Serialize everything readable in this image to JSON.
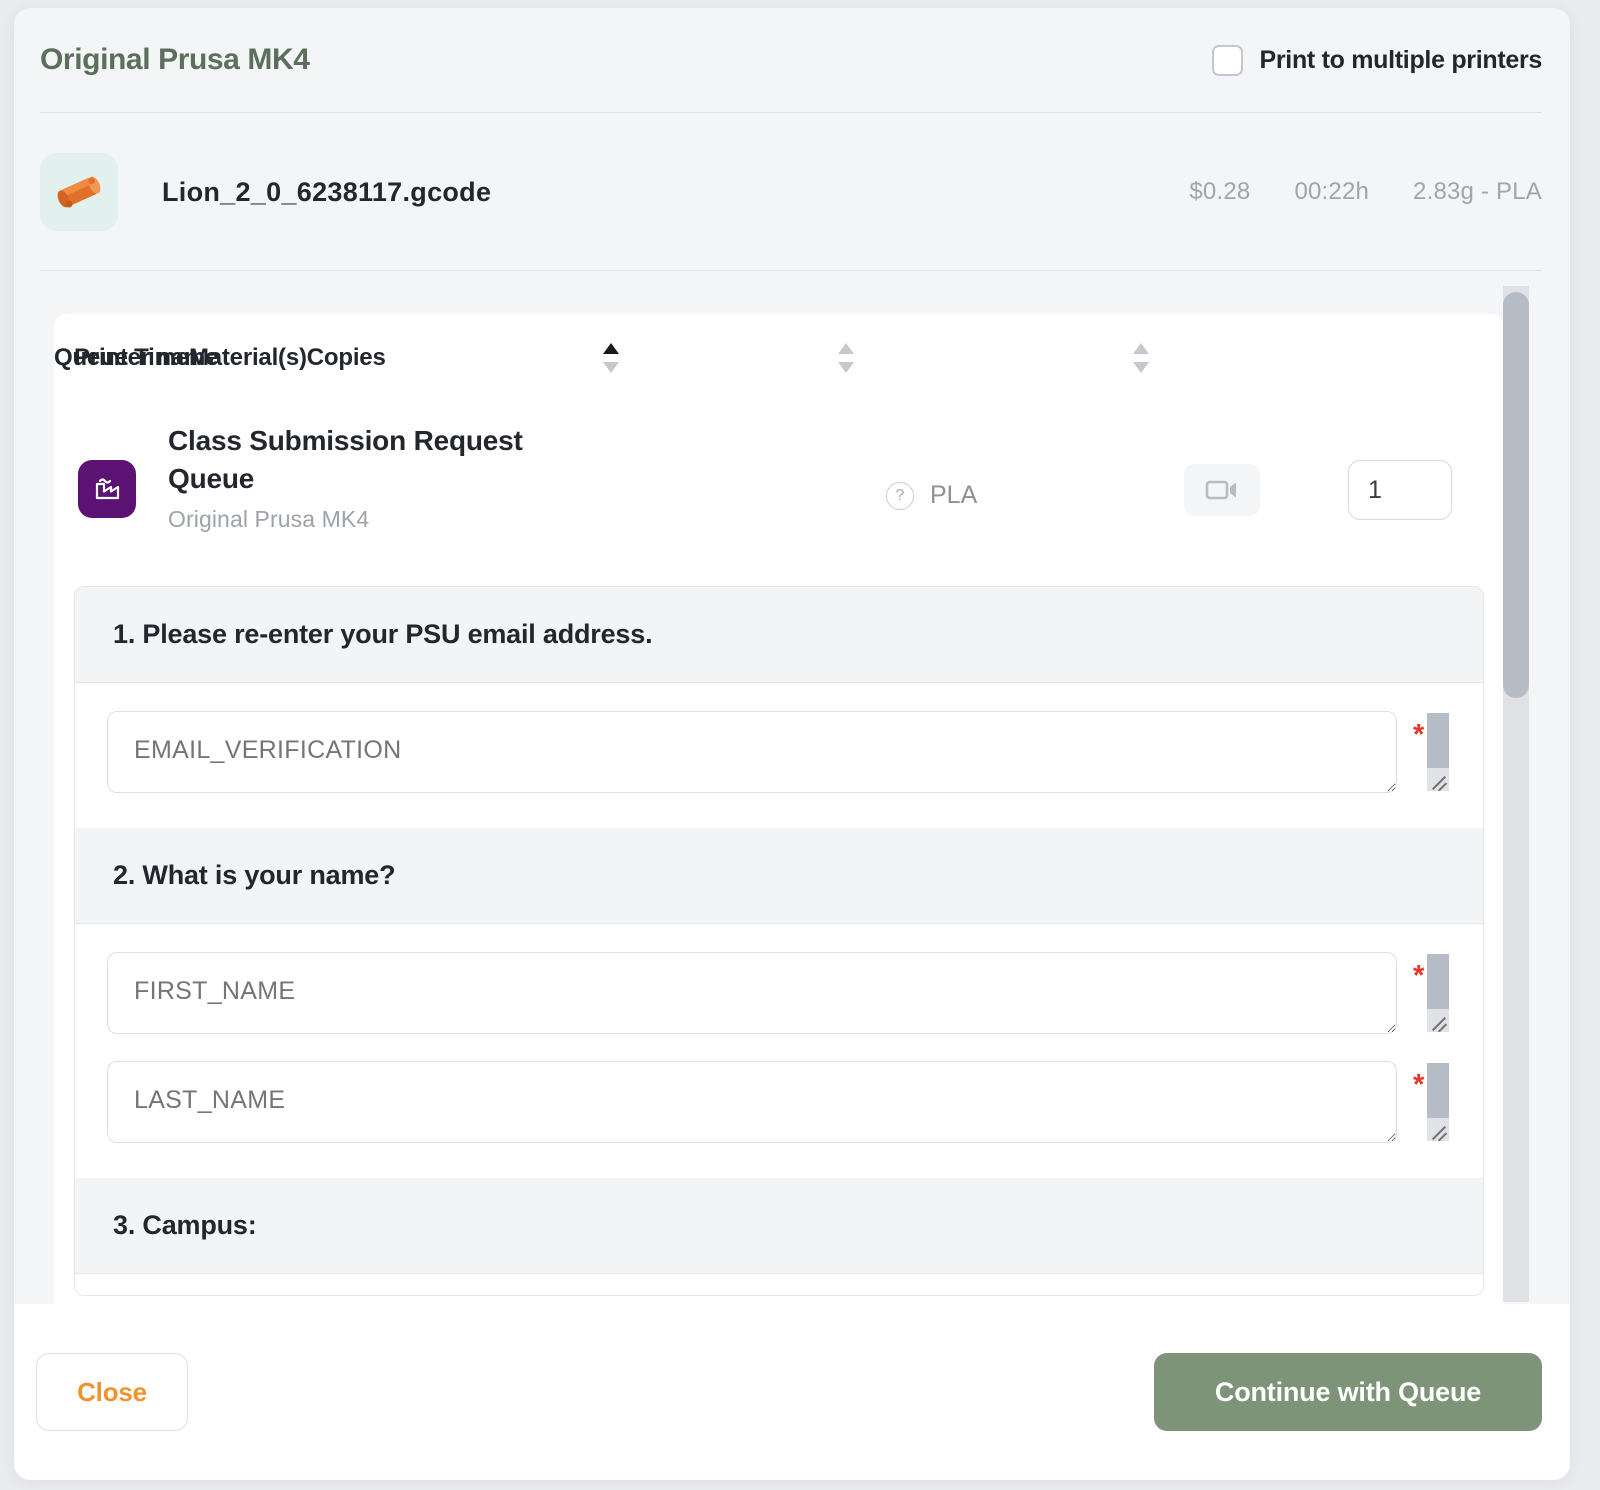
{
  "header": {
    "title": "Original Prusa MK4",
    "multi_printer_label": "Print to multiple printers",
    "multi_printer_checked": false
  },
  "file": {
    "name": "Lion_2_0_6238117.gcode",
    "cost": "$0.28",
    "duration": "00:22h",
    "weight_material": "2.83g - PLA",
    "thumbnail_icon": "3d-model-thumbnail"
  },
  "table": {
    "columns": [
      {
        "label": "Printer name",
        "sortable": true,
        "sort_state": "asc"
      },
      {
        "label": "Queue Time",
        "sortable": true,
        "sort_state": "none"
      },
      {
        "label": "Material(s)",
        "sortable": true,
        "sort_state": "none"
      },
      {
        "label": "Copies",
        "sortable": false,
        "sort_state": "none"
      }
    ],
    "row": {
      "printer_name": "Class Submission Request Queue",
      "printer_model": "Original Prusa MK4",
      "queue_time": "",
      "material": "PLA",
      "material_help_icon": "question-circle-icon",
      "camera_icon": "video-camera-icon",
      "copies_value": "1",
      "printer_avatar_icon": "factory-icon"
    }
  },
  "form": {
    "questions": [
      {
        "title": "1. Please re-enter your PSU email address.",
        "fields": [
          {
            "placeholder": "EMAIL_VERIFICATION",
            "value": "",
            "required": true,
            "required_marker": "*"
          }
        ]
      },
      {
        "title": "2. What is your name?",
        "fields": [
          {
            "placeholder": "FIRST_NAME",
            "value": "",
            "required": true,
            "required_marker": "*"
          },
          {
            "placeholder": "LAST_NAME",
            "value": "",
            "required": true,
            "required_marker": "*"
          }
        ]
      },
      {
        "title": "3. Campus:",
        "fields": []
      }
    ]
  },
  "footer": {
    "close_label": "Close",
    "continue_label": "Continue with Queue"
  },
  "colors": {
    "title_green": "#5c6f5c",
    "accent_orange": "#f0922f",
    "primary_green": "#7e9479",
    "printer_purple": "#5b1273",
    "required_red": "#e8352b"
  }
}
